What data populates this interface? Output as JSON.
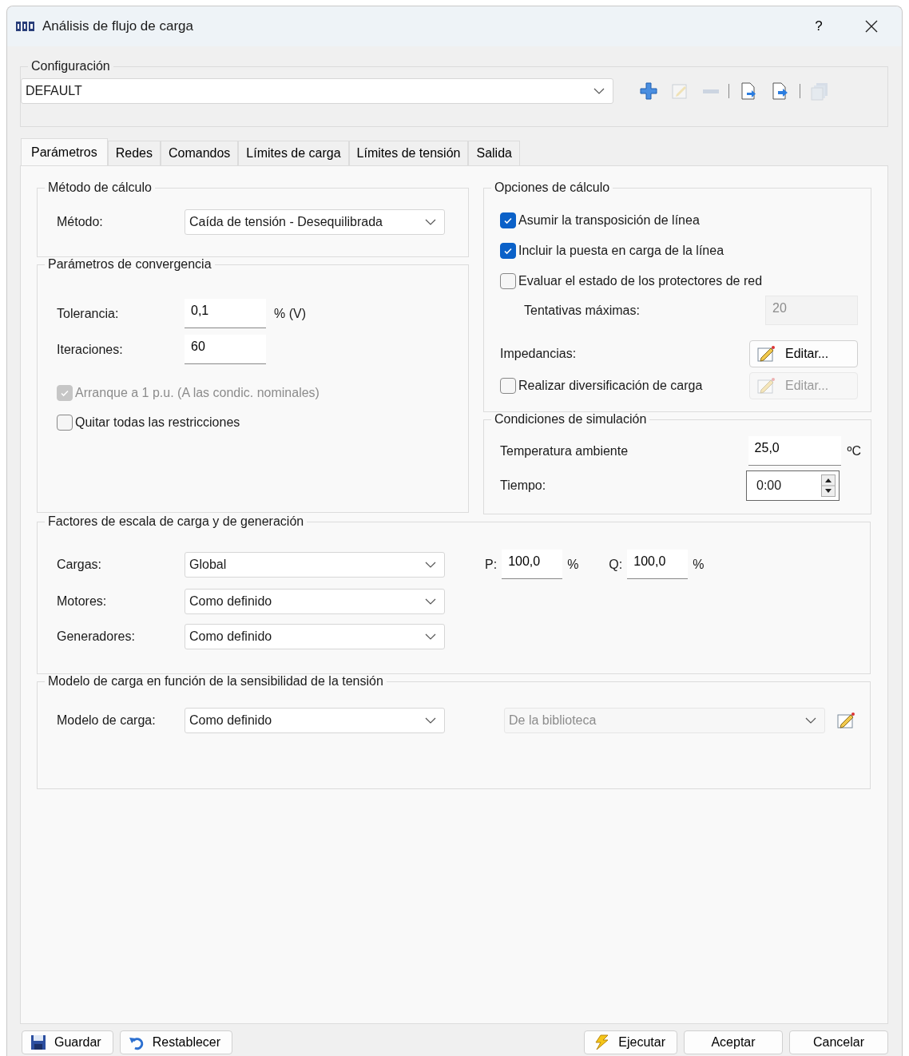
{
  "window": {
    "title": "Análisis de flujo de carga",
    "help_button": "?"
  },
  "configuration": {
    "title": "Configuración",
    "value": "DEFAULT",
    "toolbar": [
      {
        "kind": "add",
        "disabled": false
      },
      {
        "kind": "edit",
        "disabled": true
      },
      {
        "kind": "remove",
        "disabled": true
      },
      {
        "kind": "separator"
      },
      {
        "kind": "import",
        "disabled": false
      },
      {
        "kind": "export",
        "disabled": false
      },
      {
        "kind": "separator"
      },
      {
        "kind": "copy",
        "disabled": true
      }
    ]
  },
  "tabs": [
    {
      "label": "Parámetros",
      "selected": true
    },
    {
      "label": "Redes",
      "selected": false
    },
    {
      "label": "Comandos",
      "selected": false
    },
    {
      "label": "Límites de carga",
      "selected": false
    },
    {
      "label": "Límites de tensión",
      "selected": false
    },
    {
      "label": "Salida",
      "selected": false
    }
  ],
  "calculation_method": {
    "title": "Método de cálculo",
    "label": "Método:",
    "value": "Caída de tensión - Desequilibrada"
  },
  "convergence": {
    "title": "Parámetros de convergencia",
    "fields": [
      {
        "label": "Tolerancia:",
        "value": "0,1",
        "unit": "% (V)"
      },
      {
        "label": "Iteraciones:",
        "value": "60"
      }
    ],
    "checkboxes": [
      {
        "label": "Arranque a 1 p.u. (A las condic. nominales)",
        "checked": true,
        "disabled": true
      },
      {
        "label": "Quitar todas las restricciones",
        "checked": false,
        "disabled": false
      }
    ]
  },
  "calculation_options": {
    "title": "Opciones de cálculo",
    "checkboxes": [
      {
        "label": "Asumir la transposición de línea",
        "checked": true,
        "disabled": false
      },
      {
        "label": "Incluir la puesta en carga de la línea",
        "checked": true,
        "disabled": false
      },
      {
        "label": "Evaluar el estado de los protectores de red",
        "checked": false,
        "disabled": false
      }
    ],
    "max_attempts": {
      "label": "Tentativas máximas:",
      "value": "20",
      "disabled": true
    },
    "impedances": {
      "label": "Impedancias:",
      "button": "Editar...",
      "disabled": false
    },
    "diversification": {
      "label": "Realizar diversificación de carga",
      "checked": false,
      "button": "Editar...",
      "disabled": true
    }
  },
  "simulation": {
    "title": "Condiciones de simulación",
    "temperature": {
      "label": "Temperatura ambiente",
      "value": "25,0",
      "unit": "ºC"
    },
    "time": {
      "label": "Tiempo:",
      "value": "0:00"
    }
  },
  "scale_factors": {
    "title": "Factores de escala de carga y de generación",
    "rows": [
      {
        "label": "Cargas:",
        "value": "Global"
      },
      {
        "label": "Motores:",
        "value": "Como definido"
      },
      {
        "label": "Generadores:",
        "value": "Como definido"
      }
    ],
    "p": {
      "label": "P:",
      "value": "100,0",
      "unit": "%"
    },
    "q": {
      "label": "Q:",
      "value": "100,0",
      "unit": "%"
    }
  },
  "load_model": {
    "title": "Modelo de carga en función de la sensibilidad de la tensión",
    "label": "Modelo de carga:",
    "value": "Como definido",
    "library": {
      "value": "De la biblioteca",
      "disabled": true
    }
  },
  "footer_buttons": [
    {
      "kind": "save",
      "label": "Guardar"
    },
    {
      "kind": "reset",
      "label": "Restablecer"
    },
    {
      "kind": "run",
      "label": "Ejecutar"
    },
    {
      "kind": "plain",
      "label": "Aceptar"
    },
    {
      "kind": "plain",
      "label": "Cancelar"
    }
  ]
}
